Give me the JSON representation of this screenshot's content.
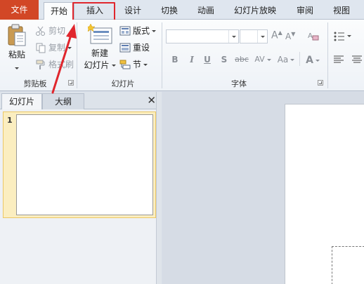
{
  "tabs": {
    "file": "文件",
    "home": "开始",
    "insert": "插入",
    "design": "设计",
    "transitions": "切换",
    "animations": "动画",
    "slideshow": "幻灯片放映",
    "review": "审阅",
    "view": "视图"
  },
  "clipboard": {
    "paste": "粘贴",
    "cut": "剪切",
    "copy": "复制",
    "format_painter": "格式刷",
    "group_label": "剪贴板"
  },
  "slides": {
    "new_slide_line1": "新建",
    "new_slide_line2": "幻灯片",
    "layout": "版式",
    "reset": "重设",
    "section": "节",
    "group_label": "幻灯片"
  },
  "font": {
    "font_name": "",
    "font_size": "",
    "grow": "A",
    "shrink": "A",
    "bold": "B",
    "italic": "I",
    "underline": "U",
    "shadow": "S",
    "strike": "abc",
    "spacing": "AV",
    "case": "Aa",
    "color": "A",
    "group_label": "字体"
  },
  "panel": {
    "tab_slides": "幻灯片",
    "tab_outline": "大纲",
    "close": "✕",
    "slide_number": "1"
  },
  "colors": {
    "file_tab": "#d24726",
    "highlight": "#e0262d",
    "selection": "#fbeec0"
  }
}
